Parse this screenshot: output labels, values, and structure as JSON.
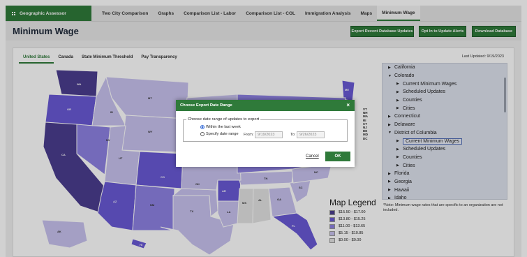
{
  "nav": {
    "brand": "Geographic Assessor",
    "items": [
      "Two City Comparison",
      "Graphs",
      "Comparison List - Labor",
      "Comparison List - COL",
      "Immigration Analysis",
      "Maps",
      "Minimum Wage"
    ]
  },
  "header": {
    "title": "Minimum Wage",
    "buttons": [
      "Export Recent Database Updates",
      "Opt In to Update Alerts",
      "Download Database"
    ]
  },
  "tabs": [
    "United States",
    "Canada",
    "State Minimum Threshold",
    "Pay Transparency"
  ],
  "last_updated": "Last Updated: 9/19/2023",
  "tree": [
    {
      "label": "California",
      "level": 0,
      "arrow": "closed"
    },
    {
      "label": "Colorado",
      "level": 0,
      "arrow": "open"
    },
    {
      "label": "Current Minimum Wages",
      "level": 1,
      "arrow": "closed"
    },
    {
      "label": "Scheduled Updates",
      "level": 1,
      "arrow": "closed"
    },
    {
      "label": "Counties",
      "level": 1,
      "arrow": "closed"
    },
    {
      "label": "Cities",
      "level": 1,
      "arrow": "closed"
    },
    {
      "label": "Connecticut",
      "level": 0,
      "arrow": "closed"
    },
    {
      "label": "Delaware",
      "level": 0,
      "arrow": "closed"
    },
    {
      "label": "District of Columbia",
      "level": 0,
      "arrow": "open"
    },
    {
      "label": "Current Minimum Wages",
      "level": 1,
      "arrow": "closed",
      "selected": true
    },
    {
      "label": "Scheduled Updates",
      "level": 1,
      "arrow": "closed"
    },
    {
      "label": "Counties",
      "level": 1,
      "arrow": "closed"
    },
    {
      "label": "Cities",
      "level": 1,
      "arrow": "closed"
    },
    {
      "label": "Florida",
      "level": 0,
      "arrow": "closed"
    },
    {
      "label": "Georgia",
      "level": 0,
      "arrow": "closed"
    },
    {
      "label": "Hawaii",
      "level": 0,
      "arrow": "closed"
    },
    {
      "label": "Idaho",
      "level": 0,
      "arrow": "closed"
    }
  ],
  "note": "*Note: Minimum wage rates that are specific to an organization are not included.",
  "legend": {
    "title": "Map Legend",
    "items": [
      {
        "label": "$15.50 - $17.00",
        "color": "#4b3d8f"
      },
      {
        "label": "$13.80 - $15.25",
        "color": "#6a5ad6"
      },
      {
        "label": "$11.00 - $13.65",
        "color": "#8e82e3"
      },
      {
        "label": "$5.15 - $10.85",
        "color": "#c9c3ef"
      },
      {
        "label": "$0.00 - $0.00",
        "color": "#e3e3e3"
      }
    ]
  },
  "map": {
    "states": [
      "WA",
      "OR",
      "CA",
      "NV",
      "ID",
      "MT",
      "WY",
      "UT",
      "AZ",
      "CO",
      "NM",
      "TX",
      "OK",
      "AR",
      "TN",
      "NC",
      "SC",
      "GA",
      "AL",
      "MS",
      "LA",
      "FL",
      "ME",
      "AK",
      "HI"
    ],
    "east_labels": [
      "VT",
      "NH",
      "MA",
      "RI",
      "CT",
      "NJ",
      "DE",
      "MD",
      "DC"
    ]
  },
  "modal": {
    "title": "Choose Export Date Range",
    "close": "×",
    "legend": "Choose date range of updates to export",
    "opt1": "Within the last week",
    "opt2": "Specify date range",
    "from_label": "From:",
    "from_value": "9/19/2023",
    "to_label": "To:",
    "to_value": "9/26/2023",
    "cancel": "Cancel",
    "ok": "OK"
  }
}
